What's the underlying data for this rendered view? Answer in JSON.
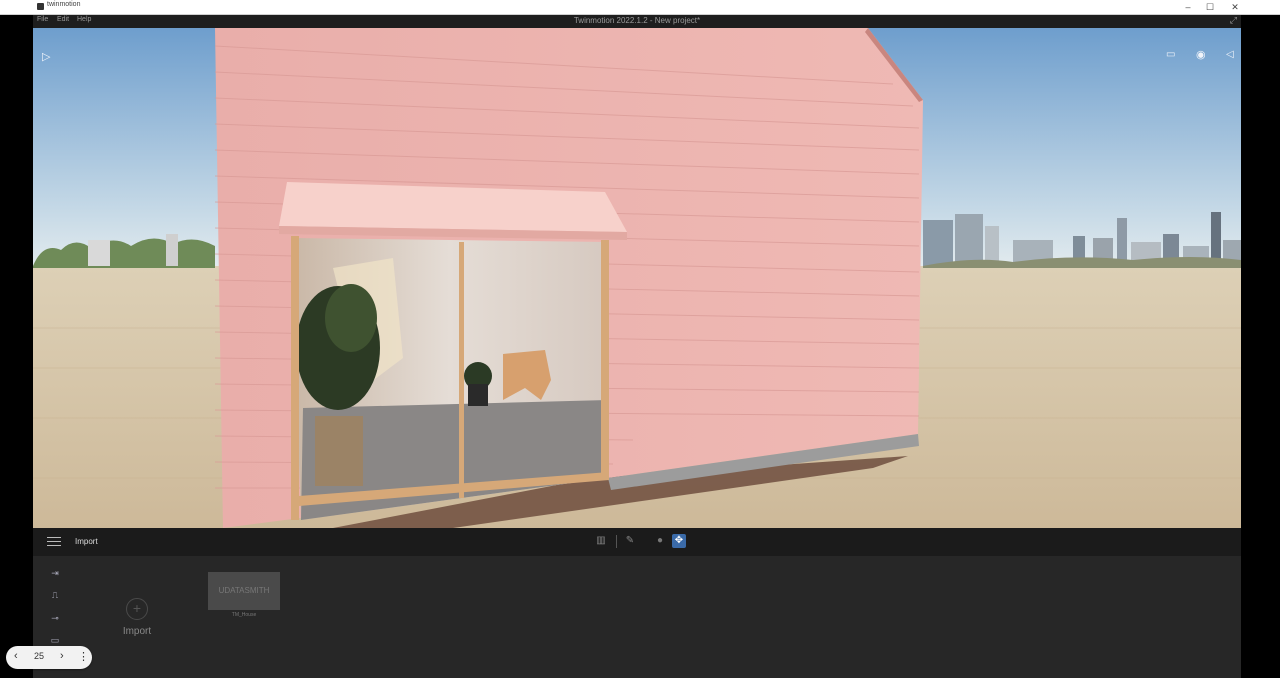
{
  "window": {
    "app_name": "twinmotion",
    "title": "Twinmotion 2022.1.2 - New project*",
    "minimize": "–",
    "maximize": "☐",
    "close": "✕"
  },
  "menu": {
    "file": "File",
    "edit": "Edit",
    "help": "Help"
  },
  "viewport": {
    "play_icon": "play-icon",
    "right_icons": [
      "view-mode-icon",
      "eye-icon",
      "collapse-left-icon"
    ]
  },
  "bottom_panel": {
    "title": "Import",
    "import_label": "Import",
    "asset_tile_text": "UDATASMITH",
    "asset_name": "TM_House",
    "sidebar_icons": [
      "import-arrow-icon",
      "path-icon",
      "link-icon",
      "screen-icon"
    ],
    "tools": [
      "library-icon",
      "eyedropper-icon",
      "circle-tool-icon",
      "move-gizmo-icon"
    ]
  },
  "pager": {
    "prev": "‹",
    "page": "25",
    "next": "›",
    "more": "⋮"
  },
  "colors": {
    "sky_top": "#6f9fcf",
    "sky_horizon": "#dbe7ee",
    "ground": "#d8c7a6",
    "wall_pink": "#eab0ac",
    "panel_bg": "#272727",
    "accent_blue": "#3a6aa8"
  }
}
